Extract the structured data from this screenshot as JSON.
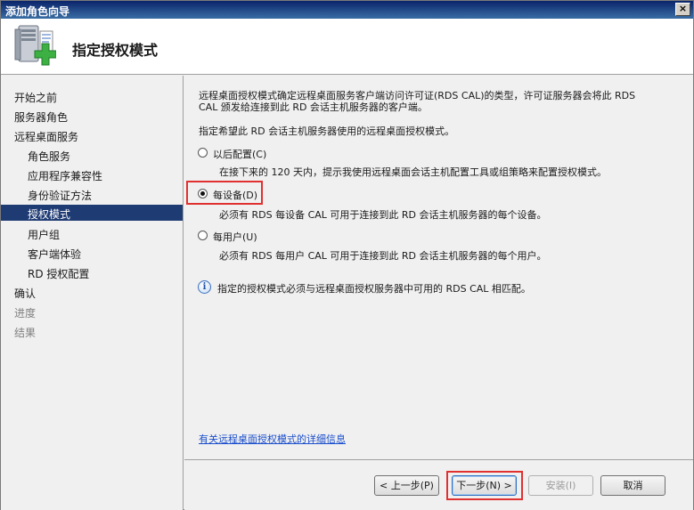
{
  "window": {
    "title": "添加角色向导",
    "close_label": "×"
  },
  "header": {
    "title": "指定授权模式",
    "icon": "server-add-icon"
  },
  "sidebar": {
    "items": [
      {
        "label": "开始之前",
        "level": 1,
        "state": "normal"
      },
      {
        "label": "服务器角色",
        "level": 1,
        "state": "normal"
      },
      {
        "label": "远程桌面服务",
        "level": 1,
        "state": "normal"
      },
      {
        "label": "角色服务",
        "level": 2,
        "state": "normal"
      },
      {
        "label": "应用程序兼容性",
        "level": 2,
        "state": "normal"
      },
      {
        "label": "身份验证方法",
        "level": 2,
        "state": "normal"
      },
      {
        "label": "授权模式",
        "level": 2,
        "state": "active"
      },
      {
        "label": "用户组",
        "level": 2,
        "state": "normal"
      },
      {
        "label": "客户端体验",
        "level": 2,
        "state": "normal"
      },
      {
        "label": "RD 授权配置",
        "level": 2,
        "state": "normal"
      },
      {
        "label": "确认",
        "level": 1,
        "state": "normal"
      },
      {
        "label": "进度",
        "level": 1,
        "state": "disabled"
      },
      {
        "label": "结果",
        "level": 1,
        "state": "disabled"
      }
    ]
  },
  "content": {
    "description_line1": "远程桌面授权模式确定远程桌面服务客户端访问许可证(RDS CAL)的类型，许可证服务器会将此 RDS",
    "description_line2": "CAL 颁发给连接到此 RD 会话主机服务器的客户端。",
    "prompt": "指定希望此 RD 会话主机服务器使用的远程桌面授权模式。",
    "options": [
      {
        "label": "以后配置(C)",
        "description": "在接下来的 120 天内，提示我使用远程桌面会话主机配置工具或组策略来配置授权模式。",
        "checked": false
      },
      {
        "label": "每设备(D)",
        "description": "必须有 RDS 每设备 CAL 可用于连接到此 RD 会话主机服务器的每个设备。",
        "checked": true
      },
      {
        "label": "每用户(U)",
        "description": "必须有 RDS 每用户 CAL 可用于连接到此 RD 会话主机服务器的每个用户。",
        "checked": false
      }
    ],
    "info_text": "指定的授权模式必须与远程桌面授权服务器中可用的 RDS CAL 相匹配。",
    "detail_link": "有关远程桌面授权模式的详细信息"
  },
  "footer": {
    "prev_label": "< 上一步(P)",
    "next_label": "下一步(N) >",
    "install_label": "安装(I)",
    "cancel_label": "取消"
  },
  "colors": {
    "active_nav": "#1f3b73",
    "highlight": "#e03030",
    "link": "#1a4ecc"
  }
}
